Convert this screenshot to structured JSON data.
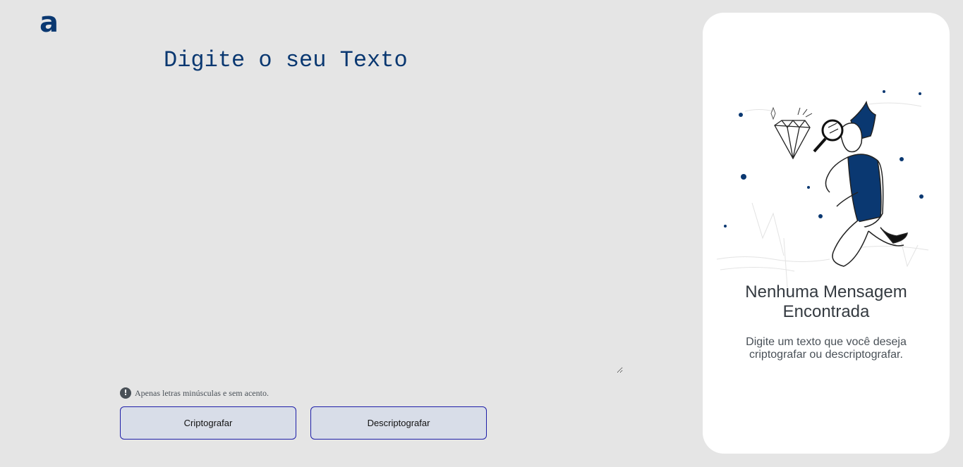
{
  "logo": {
    "letter": "a",
    "color": "#0a3871"
  },
  "main": {
    "title": "Digite o seu Texto",
    "textarea_value": "",
    "hint": {
      "icon": "exclamation-circle-icon",
      "text": "Apenas letras minúsculas e sem acento."
    },
    "buttons": {
      "encrypt_label": "Criptografar",
      "decrypt_label": "Descriptografar"
    }
  },
  "output_panel": {
    "illustration": "person-with-magnifying-glass-illustration",
    "title": "Nenhuma Mensagem Encontrada",
    "subtitle": "Digite um texto que você deseja criptografar ou descriptografar."
  },
  "colors": {
    "accent": "#0a3871",
    "background": "#e5e5e5",
    "panel": "#ffffff",
    "button_bg": "#d8dde8",
    "button_border": "#1e1ea8"
  }
}
